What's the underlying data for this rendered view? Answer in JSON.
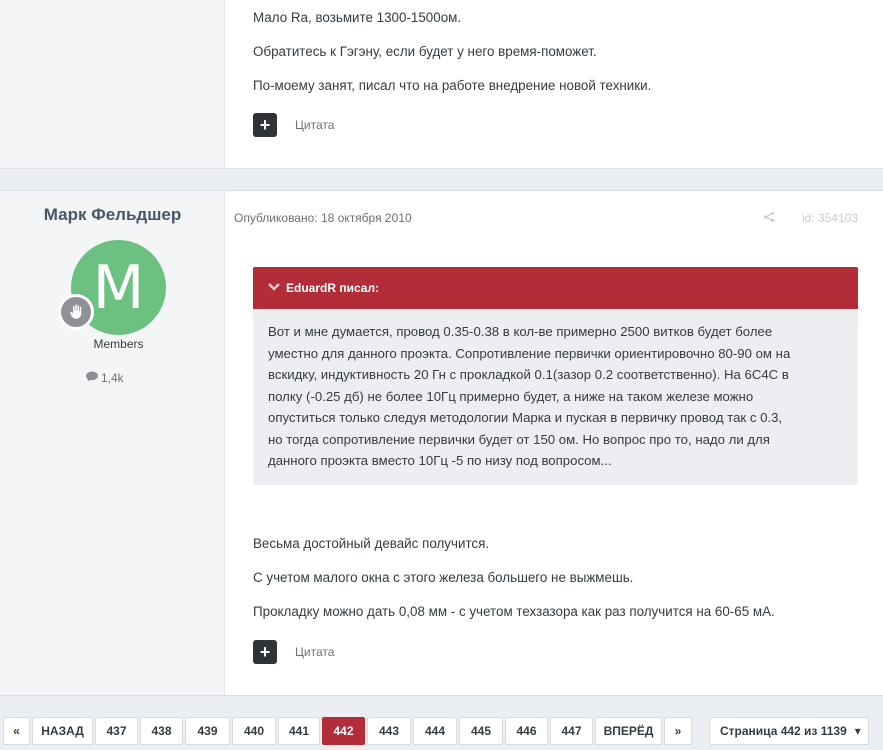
{
  "post1": {
    "paragraphs": [
      "Мало Ra, возьмите 1300-1500ом.",
      "Обратитесь к Гэгэну, если будет у него время-поможет.",
      "По-моему занят, писал что на работе внедрение новой техники."
    ],
    "quote_label": "Цитата"
  },
  "post2": {
    "author_name": "Марк Фельдшер",
    "avatar_letter": "M",
    "group": "Members",
    "reputation": "1,4k",
    "published": "Опубликовано: 18 октября 2010",
    "post_id": "id: 354103",
    "blockquote": {
      "author": "EduardR писал:",
      "lines": [
        "Вот и мне думается, провод 0.35-0.38 в кол-ве примерно 2500 витков будет более",
        "уместно для данного проэкта. Сопротивление первички ориентировочно 80-90 ом на",
        "вскидку, индуктивность 20 Гн с прокладкой 0.1(зазор 0.2 соответственно). На 6С4С в",
        "полку (-0.25 дб) не более 10Гц примерно будет, а ниже на таком железе можно",
        "опуститься только следуя методологии Марка и пуская в первичку провод так с 0.3,",
        "но тогда сопротивление первички будет от 150 ом. Но вопрос про то, надо ли для",
        "данного проэкта вместо 10Гц -5 по низу под вопросом..."
      ]
    },
    "paragraphs": [
      "Весьма достойный девайс получится.",
      "С учетом малого окна с этого железа большего не выжмешь.",
      "Прокладку можно дать 0,08 мм - с учетом техзазора как раз получится на 60-65 мА."
    ],
    "quote_label": "Цитата"
  },
  "pagination": {
    "first": "«",
    "prev": "НАЗАД",
    "pages": [
      "437",
      "438",
      "439",
      "440",
      "441",
      "442",
      "443",
      "444",
      "445",
      "446",
      "447"
    ],
    "current": "442",
    "next": "ВПЕРЁД",
    "last": "»",
    "jump_label": "Страница 442 из 1139",
    "jump_caret": "▾"
  },
  "colors": {
    "accent": "#b22d38",
    "avatar": "#6cc180",
    "author_name": "#46566a"
  },
  "icons": {
    "quote_add": "plus-icon",
    "rank": "hand-icon",
    "reputation": "speech-bubble-icon",
    "share": "share-icon",
    "quote_collapse": "chevron-down-icon"
  }
}
